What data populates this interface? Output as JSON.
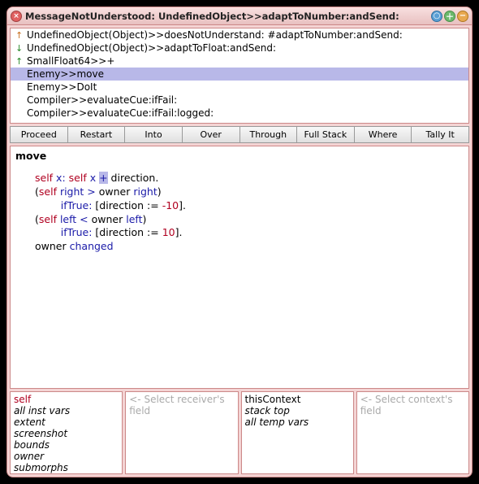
{
  "title": "MessageNotUnderstood: UndefinedObject>>adaptToNumber:andSend:",
  "stack": {
    "items": [
      {
        "icon": "↑",
        "iconClass": "icon-orange",
        "text": "UndefinedObject(Object)>>doesNotUnderstand: #adaptToNumber:andSend:"
      },
      {
        "icon": "↓",
        "iconClass": "icon-green",
        "text": "UndefinedObject(Object)>>adaptToFloat:andSend:"
      },
      {
        "icon": "↑",
        "iconClass": "icon-green",
        "text": "SmallFloat64>>+"
      },
      {
        "icon": "",
        "iconClass": "",
        "text": "Enemy>>move",
        "selected": true
      },
      {
        "icon": "",
        "iconClass": "",
        "text": "Enemy>>DoIt"
      },
      {
        "icon": "",
        "iconClass": "",
        "text": "Compiler>>evaluateCue:ifFail:"
      },
      {
        "icon": "",
        "iconClass": "",
        "text": "Compiler>>evaluateCue:ifFail:logged:"
      }
    ]
  },
  "buttons": {
    "proceed": "Proceed",
    "restart": "Restart",
    "into": "Into",
    "over": "Over",
    "through": "Through",
    "fullstack": "Full Stack",
    "where": "Where",
    "tally": "Tally It"
  },
  "code": {
    "method": "move",
    "l1_self1": "self",
    "l1_x": " x: ",
    "l1_self2": "self",
    "l1_sp": " ",
    "l1_xmsg": "x",
    "l1_sp2": " ",
    "l1_plus": "+",
    "l1_dir": " direction.",
    "l2_open": "(",
    "l2_self": "self",
    "l2_right": " right ",
    "l2_gt": ">",
    "l2_owner": " owner ",
    "l2_right2": "right",
    "l2_close": ")",
    "l3_ind": "        ",
    "l3_iftrue": "ifTrue:",
    "l3_body": " [direction ",
    "l3_assign": ":=",
    "l3_sp": " ",
    "l3_neg": "-10",
    "l3_end": "].",
    "l4_open": "(",
    "l4_self": "self",
    "l4_left": " left ",
    "l4_lt": "<",
    "l4_owner": " owner ",
    "l4_left2": "left",
    "l4_close": ")",
    "l5_ind": "        ",
    "l5_iftrue": "ifTrue:",
    "l5_body": " [direction ",
    "l5_assign": ":=",
    "l5_sp": " ",
    "l5_num": "10",
    "l5_end": "].",
    "l6_owner": "owner ",
    "l6_changed": "changed"
  },
  "inspect": {
    "receiver": {
      "items": [
        "self",
        "all inst vars",
        "extent",
        "screenshot",
        "bounds",
        "owner",
        "submorphs"
      ]
    },
    "receiverField": {
      "placeholder": "<- Select receiver's field"
    },
    "context": {
      "items": [
        "thisContext",
        "stack top",
        "all temp vars"
      ]
    },
    "contextField": {
      "placeholder": "<- Select context's field"
    }
  }
}
